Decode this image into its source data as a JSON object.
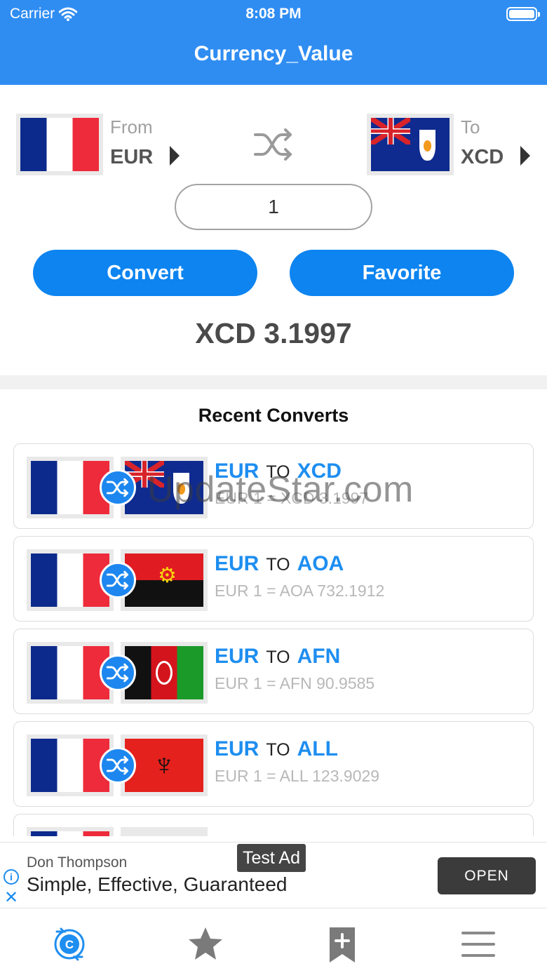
{
  "status_bar": {
    "carrier": "Carrier",
    "time": "8:08 PM",
    "wifi_icon": "wifi-icon",
    "battery_icon": "battery-icon"
  },
  "header": {
    "title": "Currency_Value"
  },
  "converter": {
    "from": {
      "label": "From",
      "code": "EUR",
      "flag": "france-flag"
    },
    "to": {
      "label": "To",
      "code": "XCD",
      "flag": "anguilla-flag"
    },
    "swap_icon": "shuffle-icon",
    "amount": "1",
    "convert_label": "Convert",
    "favorite_label": "Favorite",
    "result": "XCD 3.1997"
  },
  "recent": {
    "title": "Recent Converts",
    "to_word": "TO",
    "items": [
      {
        "from": "EUR",
        "to": "XCD",
        "rate": "EUR 1 = XCD 3.1997",
        "from_flag": "france-flag",
        "to_flag": "anguilla-flag"
      },
      {
        "from": "EUR",
        "to": "AOA",
        "rate": "EUR 1 = AOA 732.1912",
        "from_flag": "france-flag",
        "to_flag": "angola-flag"
      },
      {
        "from": "EUR",
        "to": "AFN",
        "rate": "EUR 1 = AFN 90.9585",
        "from_flag": "france-flag",
        "to_flag": "afghanistan-flag"
      },
      {
        "from": "EUR",
        "to": "ALL",
        "rate": "EUR 1 = ALL 123.9029",
        "from_flag": "france-flag",
        "to_flag": "albania-flag"
      }
    ]
  },
  "watermark": "UpdateStar.com",
  "ad": {
    "advertiser": "Don Thompson",
    "headline": "Simple, Effective, Guaranteed",
    "badge": "Test Ad",
    "cta": "OPEN",
    "info_icon": "info-icon",
    "close_icon": "close-icon"
  },
  "tabbar": {
    "tabs": [
      {
        "icon": "currency-convert-icon",
        "active": true
      },
      {
        "icon": "star-icon",
        "active": false
      },
      {
        "icon": "bookmark-add-icon",
        "active": false
      },
      {
        "icon": "menu-icon",
        "active": false
      }
    ]
  },
  "colors": {
    "primary": "#2f8df2",
    "button": "#0d84f0",
    "accent_text": "#1e8ef0"
  }
}
